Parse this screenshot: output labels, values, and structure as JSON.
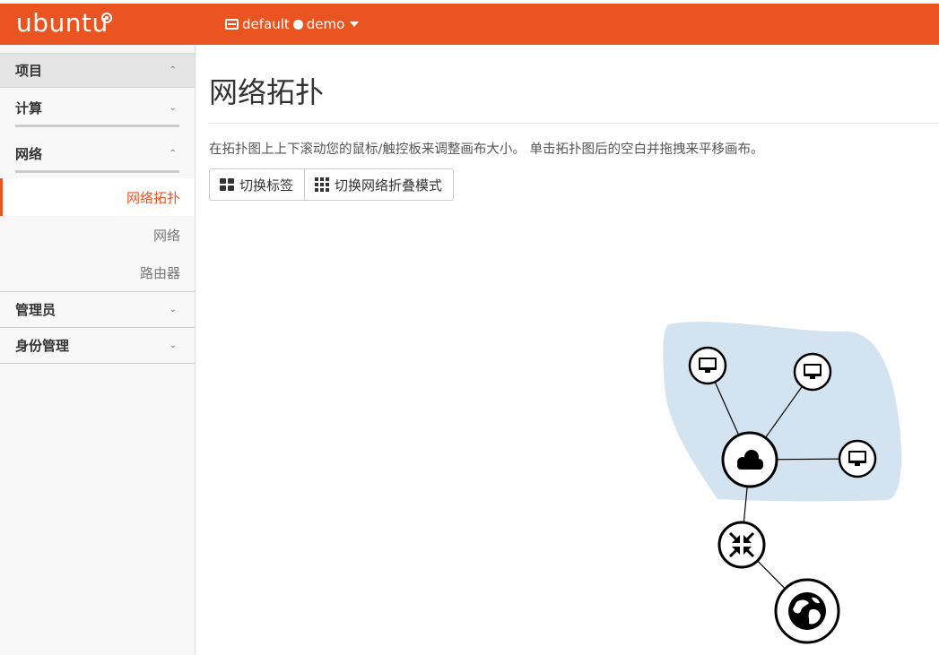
{
  "header": {
    "logo_text": "ubuntu",
    "domain": "default",
    "project": "demo",
    "brand_color": "#e95420"
  },
  "sidebar": {
    "project_label": "项目",
    "compute_label": "计算",
    "network_label": "网络",
    "items": [
      "网络拓扑",
      "网络",
      "路由器"
    ],
    "admin_label": "管理员",
    "identity_label": "身份管理"
  },
  "main": {
    "title": "网络拓扑",
    "description": "在拓扑图上上下滚动您的鼠标/触控板来调整画布大小。 单击拓扑图后的空白并拖拽来平移画布。",
    "toggle_labels_button": "切换标签",
    "toggle_collapse_button": "切换网络折叠模式"
  },
  "topology": {
    "network_fill": "#d3e3ef",
    "nodes": [
      {
        "type": "instance",
        "icon": "monitor-icon"
      },
      {
        "type": "instance",
        "icon": "monitor-icon"
      },
      {
        "type": "instance",
        "icon": "monitor-icon"
      },
      {
        "type": "network",
        "icon": "cloud-icon"
      },
      {
        "type": "router",
        "icon": "router-arrows-icon"
      },
      {
        "type": "external",
        "icon": "globe-icon"
      }
    ]
  }
}
